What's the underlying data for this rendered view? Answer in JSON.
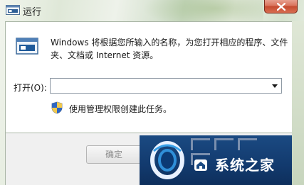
{
  "window": {
    "title": "运行",
    "close_icon": "close-icon",
    "accent_close": "#c54a2f"
  },
  "dialog": {
    "description": "Windows 将根据您所输入的名称，为您打开相应的程序、文件夹、文档或 Internet 资源。",
    "open_label": "打开(O):",
    "open_value": "",
    "admin_note": "使用管理权限创建此任务。",
    "run_icon": "run-icon",
    "shield_icon": "uac-shield-icon"
  },
  "footer": {
    "ok_label": "确定"
  },
  "watermark": {
    "text": "系统之家",
    "logo_icon": "watermark-logo-icon",
    "house_icon": "house-icon"
  }
}
